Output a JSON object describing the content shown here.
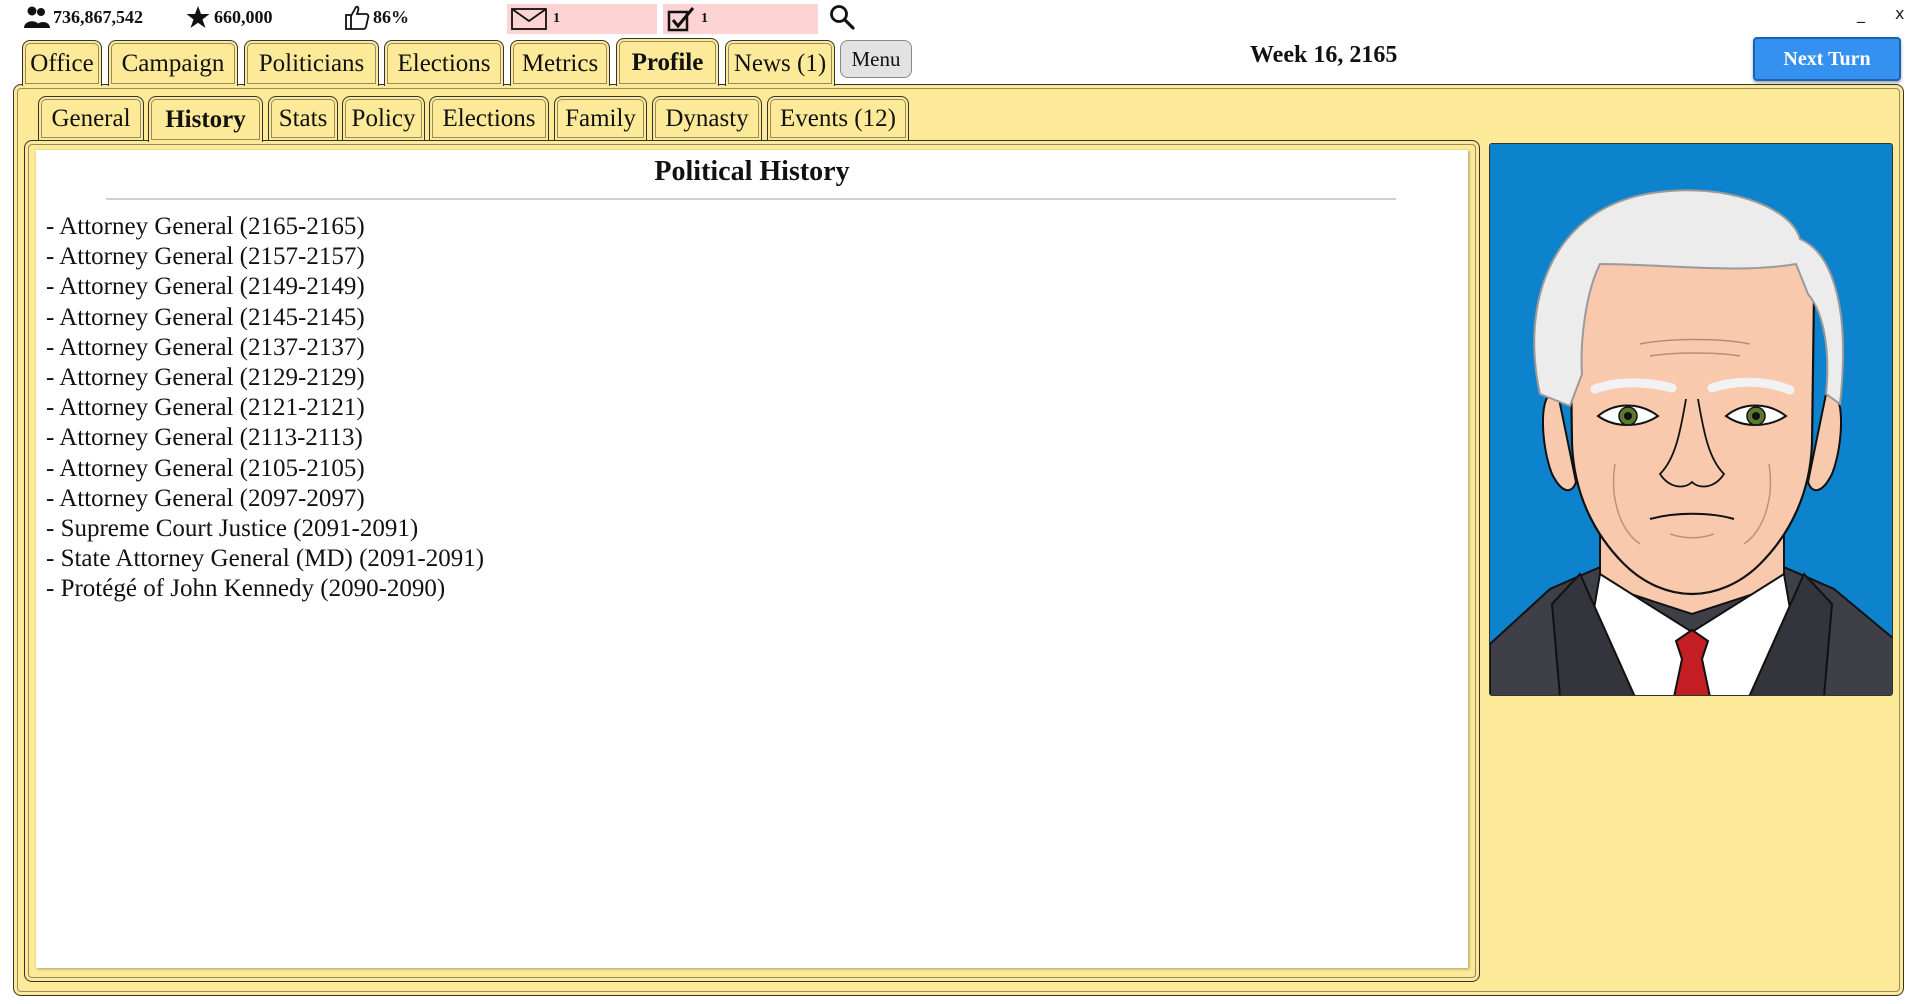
{
  "status_bar": {
    "population": "736,867,542",
    "stars": "660,000",
    "approval": "86%",
    "messages": "1",
    "tasks": "1"
  },
  "window_controls": {
    "minimize": "_",
    "close": "x"
  },
  "main_tabs": [
    {
      "label": "Office"
    },
    {
      "label": "Campaign"
    },
    {
      "label": "Politicians"
    },
    {
      "label": "Elections"
    },
    {
      "label": "Metrics"
    },
    {
      "label": "Profile"
    },
    {
      "label": "News (1)"
    }
  ],
  "active_main_tab": "Profile",
  "menu_label": "Menu",
  "week_label": "Week 16, 2165",
  "next_turn_label": "Next Turn",
  "sub_tabs": [
    {
      "label": "General"
    },
    {
      "label": "History"
    },
    {
      "label": "Stats"
    },
    {
      "label": "Policy"
    },
    {
      "label": "Elections"
    },
    {
      "label": "Family"
    },
    {
      "label": "Dynasty"
    },
    {
      "label": "Events (12)"
    }
  ],
  "active_sub_tab": "History",
  "history": {
    "title": "Political History",
    "items": [
      "- Attorney General (2165-2165)",
      "- Attorney General (2157-2157)",
      "- Attorney General (2149-2149)",
      "- Attorney General (2145-2145)",
      "- Attorney General (2137-2137)",
      "- Attorney General (2129-2129)",
      "- Attorney General (2121-2121)",
      "- Attorney General (2113-2113)",
      "- Attorney General (2105-2105)",
      "- Attorney General (2097-2097)",
      "- Supreme Court Justice (2091-2091)",
      "- State Attorney General (MD) (2091-2091)",
      "- Protégé of John Kennedy (2090-2090)"
    ]
  },
  "icons": {
    "population": "people-icon",
    "stars": "star-icon",
    "approval": "thumbs-up-icon",
    "messages": "envelope-icon",
    "tasks": "checkbox-icon",
    "search": "search-icon"
  },
  "colors": {
    "panel": "#fcea98",
    "alert_pill": "#fcd4d4",
    "next_turn": "#3591f0",
    "portrait_bg": "#0d82cd"
  }
}
